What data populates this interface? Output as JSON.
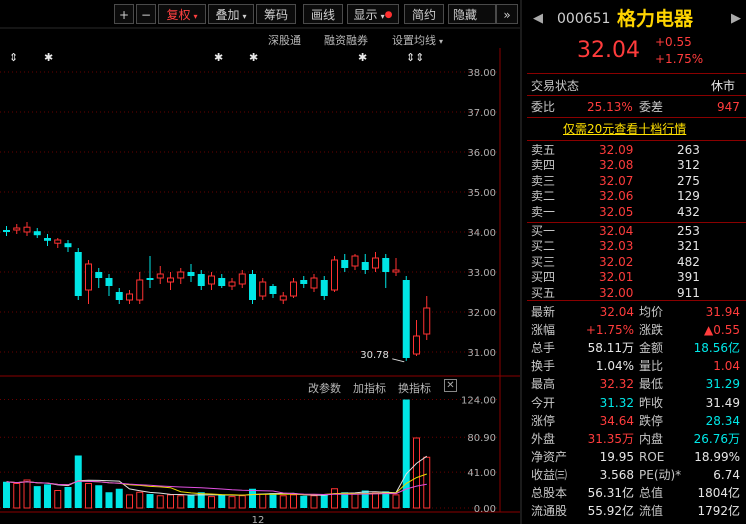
{
  "toolbar": {
    "plus": "+",
    "minus": "−",
    "fuquan": "复权",
    "diejia": "叠加",
    "chouma": "筹码",
    "huaxian": "画线",
    "xianshi": "显示",
    "jianyue": "简约",
    "yincang": "隐藏"
  },
  "sub_toolbar": {
    "shengutong": "深股通",
    "rongzi": "融资融券",
    "shezhi": "设置均线"
  },
  "indicator_toolbar": {
    "gaicanshu": "改参数",
    "jiazhibiao": "加指标",
    "huanzhibiao": "换指标",
    "close": "✕"
  },
  "markers": {
    "arrow": "⇕",
    "star": "✱",
    "arrows_double": "⇕⇕"
  },
  "chart_data": {
    "type": "candlestick",
    "price_axis": {
      "ticks": [
        "38.00",
        "37.00",
        "36.00",
        "35.00",
        "34.00",
        "33.00",
        "32.00",
        "31.00"
      ],
      "ylim": [
        30.5,
        38.6
      ]
    },
    "volume_axis": {
      "ticks": [
        "124.00",
        "80.90",
        "41.00",
        "0.00"
      ],
      "ylim": [
        0,
        128
      ]
    },
    "x_tick": "12",
    "low_annotation": "30.78",
    "candles": [
      {
        "o": 34.05,
        "c": 34.0,
        "h": 34.15,
        "l": 33.9,
        "v": 30,
        "up": false
      },
      {
        "o": 34.05,
        "c": 34.1,
        "h": 34.2,
        "l": 33.95,
        "v": 28,
        "up": true
      },
      {
        "o": 34.0,
        "c": 34.12,
        "h": 34.25,
        "l": 33.9,
        "v": 32,
        "up": true
      },
      {
        "o": 34.02,
        "c": 33.92,
        "h": 34.1,
        "l": 33.85,
        "v": 25,
        "up": false
      },
      {
        "o": 33.85,
        "c": 33.78,
        "h": 33.95,
        "l": 33.65,
        "v": 27,
        "up": false
      },
      {
        "o": 33.72,
        "c": 33.8,
        "h": 33.85,
        "l": 33.6,
        "v": 20,
        "up": true
      },
      {
        "o": 33.72,
        "c": 33.62,
        "h": 33.8,
        "l": 33.5,
        "v": 24,
        "up": false
      },
      {
        "o": 33.5,
        "c": 32.4,
        "h": 33.6,
        "l": 32.3,
        "v": 60,
        "up": false
      },
      {
        "o": 32.55,
        "c": 33.2,
        "h": 33.3,
        "l": 32.2,
        "v": 28,
        "up": true
      },
      {
        "o": 33.0,
        "c": 32.85,
        "h": 33.1,
        "l": 32.6,
        "v": 26,
        "up": false
      },
      {
        "o": 32.85,
        "c": 32.65,
        "h": 32.95,
        "l": 32.4,
        "v": 18,
        "up": false
      },
      {
        "o": 32.5,
        "c": 32.3,
        "h": 32.6,
        "l": 32.2,
        "v": 22,
        "up": false
      },
      {
        "o": 32.3,
        "c": 32.45,
        "h": 32.55,
        "l": 32.2,
        "v": 15,
        "up": true
      },
      {
        "o": 32.3,
        "c": 32.8,
        "h": 33.0,
        "l": 32.2,
        "v": 18,
        "up": true
      },
      {
        "o": 32.85,
        "c": 32.8,
        "h": 33.4,
        "l": 32.6,
        "v": 16,
        "up": false
      },
      {
        "o": 32.85,
        "c": 32.95,
        "h": 33.15,
        "l": 32.7,
        "v": 14,
        "up": true
      },
      {
        "o": 32.75,
        "c": 32.85,
        "h": 33.0,
        "l": 32.55,
        "v": 15,
        "up": true
      },
      {
        "o": 32.85,
        "c": 33.0,
        "h": 33.1,
        "l": 32.7,
        "v": 14,
        "up": true
      },
      {
        "o": 33.0,
        "c": 32.9,
        "h": 33.2,
        "l": 32.75,
        "v": 15,
        "up": false
      },
      {
        "o": 32.95,
        "c": 32.65,
        "h": 33.05,
        "l": 32.55,
        "v": 18,
        "up": false
      },
      {
        "o": 32.7,
        "c": 32.9,
        "h": 33.0,
        "l": 32.55,
        "v": 13,
        "up": true
      },
      {
        "o": 32.85,
        "c": 32.65,
        "h": 32.95,
        "l": 32.6,
        "v": 15,
        "up": false
      },
      {
        "o": 32.65,
        "c": 32.75,
        "h": 32.85,
        "l": 32.55,
        "v": 13,
        "up": true
      },
      {
        "o": 32.7,
        "c": 32.95,
        "h": 33.05,
        "l": 32.6,
        "v": 14,
        "up": true
      },
      {
        "o": 32.95,
        "c": 32.3,
        "h": 33.05,
        "l": 32.2,
        "v": 22,
        "up": false
      },
      {
        "o": 32.4,
        "c": 32.75,
        "h": 32.85,
        "l": 32.3,
        "v": 16,
        "up": true
      },
      {
        "o": 32.65,
        "c": 32.45,
        "h": 32.7,
        "l": 32.35,
        "v": 17,
        "up": false
      },
      {
        "o": 32.3,
        "c": 32.4,
        "h": 32.5,
        "l": 32.2,
        "v": 14,
        "up": true
      },
      {
        "o": 32.4,
        "c": 32.75,
        "h": 32.85,
        "l": 32.35,
        "v": 15,
        "up": true
      },
      {
        "o": 32.8,
        "c": 32.7,
        "h": 32.9,
        "l": 32.6,
        "v": 14,
        "up": false
      },
      {
        "o": 32.6,
        "c": 32.85,
        "h": 32.95,
        "l": 32.5,
        "v": 14,
        "up": true
      },
      {
        "o": 32.8,
        "c": 32.4,
        "h": 32.9,
        "l": 32.3,
        "v": 16,
        "up": false
      },
      {
        "o": 32.55,
        "c": 33.3,
        "h": 33.4,
        "l": 32.5,
        "v": 22,
        "up": true
      },
      {
        "o": 33.3,
        "c": 33.1,
        "h": 33.45,
        "l": 33.0,
        "v": 18,
        "up": false
      },
      {
        "o": 33.15,
        "c": 33.4,
        "h": 33.45,
        "l": 33.05,
        "v": 16,
        "up": true
      },
      {
        "o": 33.25,
        "c": 33.05,
        "h": 33.45,
        "l": 32.95,
        "v": 20,
        "up": false
      },
      {
        "o": 33.1,
        "c": 33.35,
        "h": 33.5,
        "l": 33.0,
        "v": 17,
        "up": true
      },
      {
        "o": 33.35,
        "c": 33.0,
        "h": 33.45,
        "l": 32.6,
        "v": 19,
        "up": false
      },
      {
        "o": 33.0,
        "c": 33.05,
        "h": 33.35,
        "l": 32.9,
        "v": 15,
        "up": true
      },
      {
        "o": 32.8,
        "c": 30.85,
        "h": 32.9,
        "l": 30.78,
        "v": 124,
        "up": false
      },
      {
        "o": 30.95,
        "c": 31.4,
        "h": 31.8,
        "l": 30.9,
        "v": 80,
        "up": true
      },
      {
        "o": 31.45,
        "c": 32.1,
        "h": 32.4,
        "l": 31.3,
        "v": 58,
        "up": true
      }
    ]
  },
  "stock": {
    "code": "000651",
    "name": "格力电器",
    "price": "32.04",
    "change": "+0.55",
    "change_pct": "+1.75%",
    "status_label": "交易状态",
    "status_value": "休市",
    "weibi_label": "委比",
    "weibi_value": "25.13%",
    "weicha_label": "委差",
    "weicha_value": "947",
    "promo": "仅需20元查看十档行情"
  },
  "sell": [
    {
      "label": "卖五",
      "price": "32.09",
      "vol": "263"
    },
    {
      "label": "卖四",
      "price": "32.08",
      "vol": "312"
    },
    {
      "label": "卖三",
      "price": "32.07",
      "vol": "275"
    },
    {
      "label": "卖二",
      "price": "32.06",
      "vol": "129"
    },
    {
      "label": "卖一",
      "price": "32.05",
      "vol": "432"
    }
  ],
  "buy": [
    {
      "label": "买一",
      "price": "32.04",
      "vol": "253"
    },
    {
      "label": "买二",
      "price": "32.03",
      "vol": "321"
    },
    {
      "label": "买三",
      "price": "32.02",
      "vol": "482"
    },
    {
      "label": "买四",
      "price": "32.01",
      "vol": "391"
    },
    {
      "label": "买五",
      "price": "32.00",
      "vol": "911"
    }
  ],
  "stats": [
    {
      "l1": "最新",
      "v1": "32.04",
      "c1": "red",
      "l2": "均价",
      "v2": "31.94",
      "c2": "red"
    },
    {
      "l1": "涨幅",
      "v1": "+1.75%",
      "c1": "red",
      "l2": "涨跌",
      "v2": "▲0.55",
      "c2": "red"
    },
    {
      "l1": "总手",
      "v1": "58.11万",
      "c1": "wht",
      "l2": "金额",
      "v2": "18.56亿",
      "c2": "grn"
    },
    {
      "l1": "换手",
      "v1": "1.04%",
      "c1": "wht",
      "l2": "量比",
      "v2": "1.04",
      "c2": "red"
    },
    {
      "l1": "最高",
      "v1": "32.32",
      "c1": "red",
      "l2": "最低",
      "v2": "31.29",
      "c2": "grn"
    },
    {
      "l1": "今开",
      "v1": "31.32",
      "c1": "grn",
      "l2": "昨收",
      "v2": "31.49",
      "c2": "wht"
    },
    {
      "l1": "涨停",
      "v1": "34.64",
      "c1": "red",
      "l2": "跌停",
      "v2": "28.34",
      "c2": "grn"
    },
    {
      "l1": "外盘",
      "v1": "31.35万",
      "c1": "red",
      "l2": "内盘",
      "v2": "26.76万",
      "c2": "grn"
    },
    {
      "l1": "净资产",
      "v1": "19.95",
      "c1": "wht",
      "l2": "ROE",
      "v2": "18.99%",
      "c2": "wht"
    },
    {
      "l1": "收益㈢",
      "v1": "3.568",
      "c1": "wht",
      "l2": "PE(动)*",
      "v2": "6.74",
      "c2": "wht"
    },
    {
      "l1": "总股本",
      "v1": "56.31亿",
      "c1": "wht",
      "l2": "总值",
      "v2": "1804亿",
      "c2": "wht"
    },
    {
      "l1": "流通股",
      "v1": "55.92亿",
      "c1": "wht",
      "l2": "流值",
      "v2": "1792亿",
      "c2": "wht"
    }
  ],
  "colors": {
    "up": "#ff3232",
    "down": "#00e6e6",
    "ma_white": "#e0e0e0",
    "ma_yellow": "#e8d800",
    "ma_pink": "#e050e0"
  }
}
